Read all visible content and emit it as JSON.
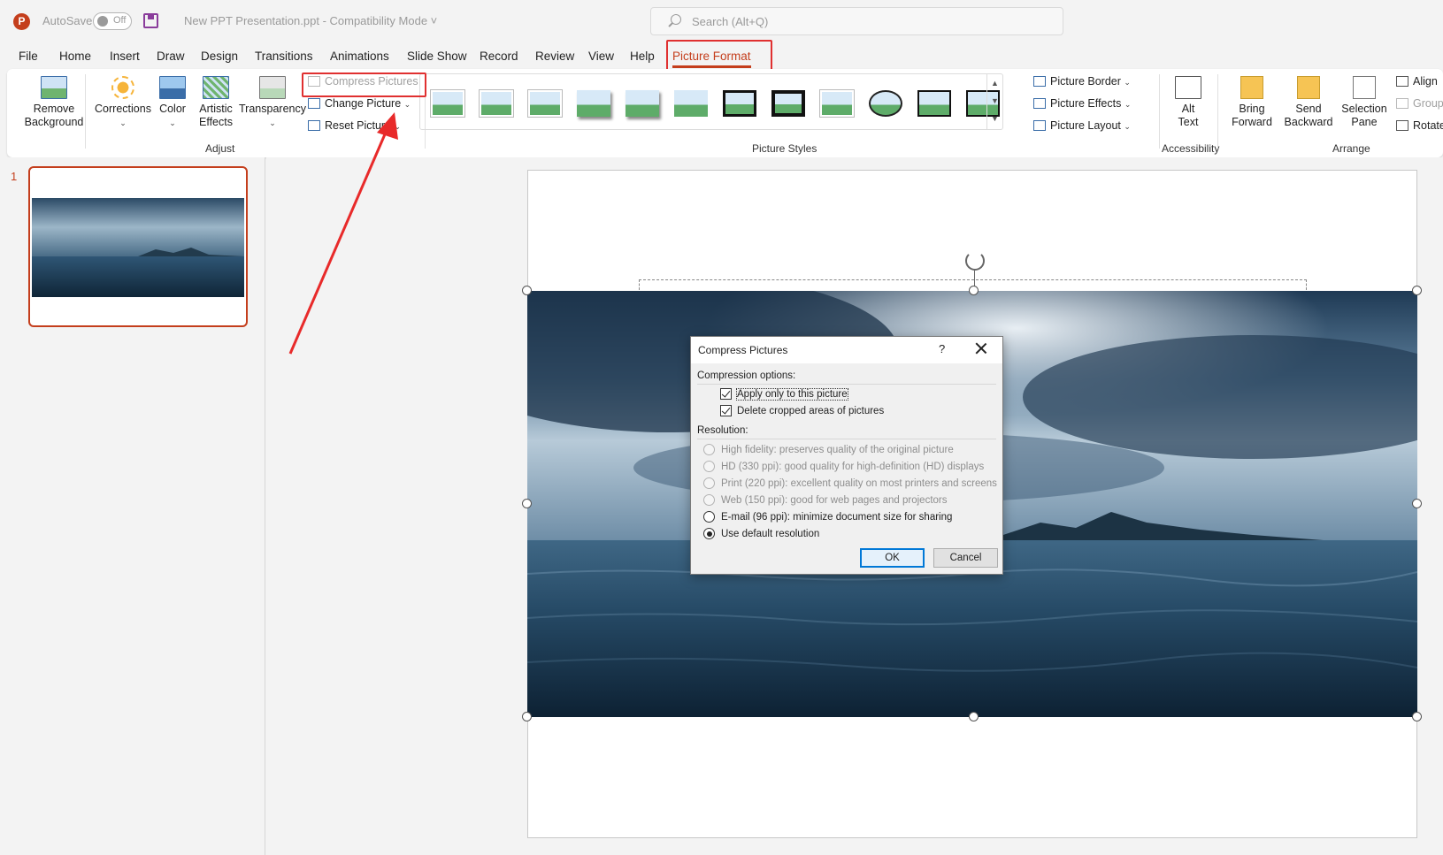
{
  "titlebar": {
    "autosave_label": "AutoSave",
    "autosave_state": "Off",
    "document_title": "New PPT Presentation.ppt  -  Compatibility Mode  ˅",
    "search_placeholder": "Search (Alt+Q)"
  },
  "tabs": [
    {
      "label": "File"
    },
    {
      "label": "Home"
    },
    {
      "label": "Insert"
    },
    {
      "label": "Draw"
    },
    {
      "label": "Design"
    },
    {
      "label": "Transitions"
    },
    {
      "label": "Animations"
    },
    {
      "label": "Slide Show"
    },
    {
      "label": "Record"
    },
    {
      "label": "Review"
    },
    {
      "label": "View"
    },
    {
      "label": "Help"
    },
    {
      "label": "Picture Format",
      "active": true
    }
  ],
  "ribbon": {
    "adjust": {
      "remove_background": [
        "Remove",
        "Background"
      ],
      "corrections": "Corrections",
      "color": "Color",
      "artistic_effects": [
        "Artistic",
        "Effects"
      ],
      "transparency": "Transparency",
      "compress_pictures": "Compress Pictures",
      "change_picture": "Change Picture",
      "reset_picture": "Reset Picture",
      "group_label": "Adjust"
    },
    "picture_styles": {
      "group_label": "Picture Styles",
      "picture_border": "Picture Border",
      "picture_effects": "Picture Effects",
      "picture_layout": "Picture Layout"
    },
    "accessibility": {
      "alt_text": [
        "Alt",
        "Text"
      ],
      "group_label": "Accessibility"
    },
    "arrange": {
      "bring_forward": [
        "Bring",
        "Forward"
      ],
      "send_backward": [
        "Send",
        "Backward"
      ],
      "selection_pane": [
        "Selection",
        "Pane"
      ],
      "align": "Align",
      "group": "Group",
      "rotate": "Rotate",
      "group_label": "Arrange"
    }
  },
  "slides_panel": {
    "slide_number": "1"
  },
  "dialog": {
    "title": "Compress Pictures",
    "help": "?",
    "compression_options_label": "Compression options:",
    "apply_only": {
      "label": "Apply only to this picture",
      "checked": true
    },
    "delete_cropped": {
      "label": "Delete cropped areas of pictures",
      "checked": true
    },
    "resolution_label": "Resolution:",
    "resolutions": [
      {
        "label": "High fidelity: preserves quality of the original picture",
        "enabled": false,
        "selected": false
      },
      {
        "label": "HD (330 ppi): good quality for high-definition (HD) displays",
        "enabled": false,
        "selected": false
      },
      {
        "label": "Print (220 ppi): excellent quality on most printers and screens",
        "enabled": false,
        "selected": false
      },
      {
        "label": "Web (150 ppi): good for web pages and projectors",
        "enabled": false,
        "selected": false
      },
      {
        "label": "E-mail (96 ppi): minimize document size for sharing",
        "enabled": true,
        "selected": false
      },
      {
        "label": "Use default resolution",
        "enabled": true,
        "selected": true
      }
    ],
    "ok": "OK",
    "cancel": "Cancel"
  },
  "colors": {
    "accent": "#c43e1c",
    "highlight_box": "#e03030",
    "default_button_border": "#0078d7"
  }
}
